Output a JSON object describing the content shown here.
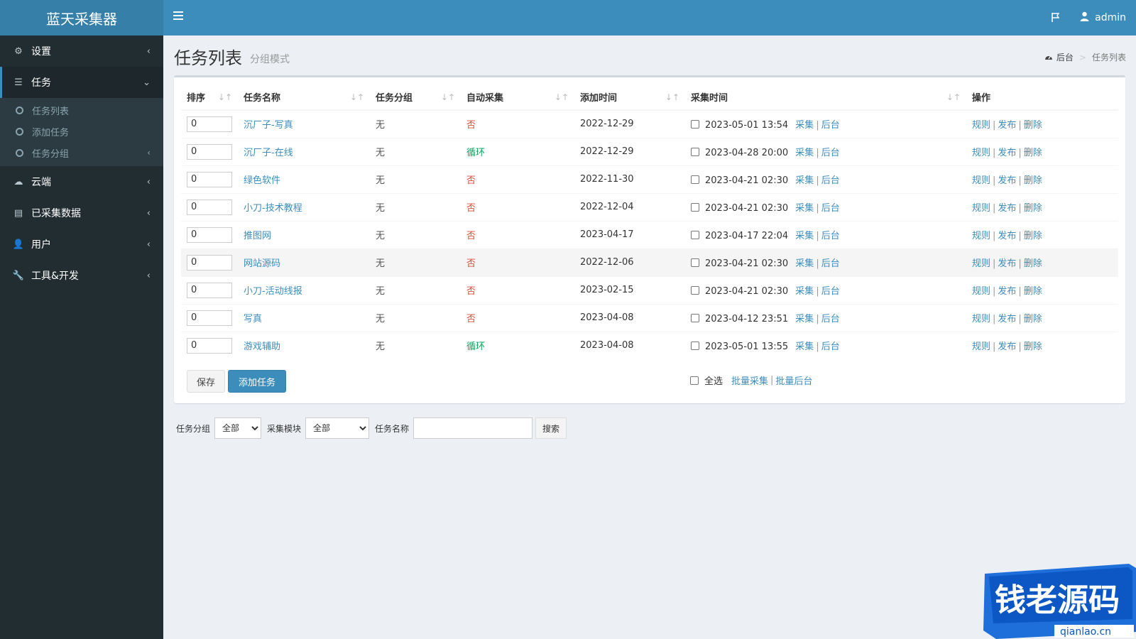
{
  "app": {
    "logo": "蓝天采集器"
  },
  "header": {
    "user": "admin"
  },
  "sidebar": {
    "items": [
      {
        "label": "设置",
        "icon": "gear-icon"
      },
      {
        "label": "任务",
        "icon": "list-icon",
        "expanded": true,
        "children": [
          {
            "label": "任务列表"
          },
          {
            "label": "添加任务"
          },
          {
            "label": "任务分组"
          }
        ]
      },
      {
        "label": "云端",
        "icon": "cloud-icon"
      },
      {
        "label": "已采集数据",
        "icon": "database-icon"
      },
      {
        "label": "用户",
        "icon": "user-icon"
      },
      {
        "label": "工具&开发",
        "icon": "wrench-icon"
      }
    ]
  },
  "page": {
    "title": "任务列表",
    "subtitle": "分组模式"
  },
  "breadcrumb": [
    "后台",
    "任务列表"
  ],
  "table": {
    "headers": [
      "排序",
      "任务名称",
      "任务分组",
      "自动采集",
      "添加时间",
      "采集时间",
      "操作"
    ],
    "rows": [
      {
        "order": "0",
        "name": "沉厂子-写真",
        "group": "无",
        "auto": "否",
        "added": "2022-12-29",
        "collect_time": "2023-05-01 13:54"
      },
      {
        "order": "0",
        "name": "沉厂子-在线",
        "group": "无",
        "auto": "循环",
        "added": "2022-12-29",
        "collect_time": "2023-04-28 20:00"
      },
      {
        "order": "0",
        "name": "绿色软件",
        "group": "无",
        "auto": "否",
        "added": "2022-11-30",
        "collect_time": "2023-04-21 02:30"
      },
      {
        "order": "0",
        "name": "小刀-技术教程",
        "group": "无",
        "auto": "否",
        "added": "2022-12-04",
        "collect_time": "2023-04-21 02:30"
      },
      {
        "order": "0",
        "name": "推图网",
        "group": "无",
        "auto": "否",
        "added": "2023-04-17",
        "collect_time": "2023-04-17 22:04"
      },
      {
        "order": "0",
        "name": "网站源码",
        "group": "无",
        "auto": "否",
        "added": "2022-12-06",
        "collect_time": "2023-04-21 02:30"
      },
      {
        "order": "0",
        "name": "小刀-活动线报",
        "group": "无",
        "auto": "否",
        "added": "2023-02-15",
        "collect_time": "2023-04-21 02:30"
      },
      {
        "order": "0",
        "name": "写真",
        "group": "无",
        "auto": "否",
        "added": "2023-04-08",
        "collect_time": "2023-04-12 23:51"
      },
      {
        "order": "0",
        "name": "游戏辅助",
        "group": "无",
        "auto": "循环",
        "added": "2023-04-08",
        "collect_time": "2023-05-01 13:55"
      }
    ],
    "collect_links": [
      "采集",
      "后台"
    ],
    "action_links": [
      "规则",
      "发布",
      "删除"
    ]
  },
  "buttons": {
    "save": "保存",
    "add_task": "添加任务"
  },
  "batch": {
    "select_all": "全选",
    "batch_collect": "批量采集",
    "batch_backend": "批量后台"
  },
  "filter": {
    "group_label": "任务分组",
    "group_value": "全部",
    "module_label": "采集模块",
    "module_value": "全部",
    "name_label": "任务名称",
    "name_value": "",
    "search": "搜索"
  },
  "watermark": {
    "text": "钱老源码",
    "domain": "qianlao.cn"
  },
  "colors": {
    "header": "#3c8dbc",
    "sidebar": "#222d32",
    "link": "#3c8dbc",
    "no": "#dd4b39",
    "loop": "#00a65a"
  }
}
